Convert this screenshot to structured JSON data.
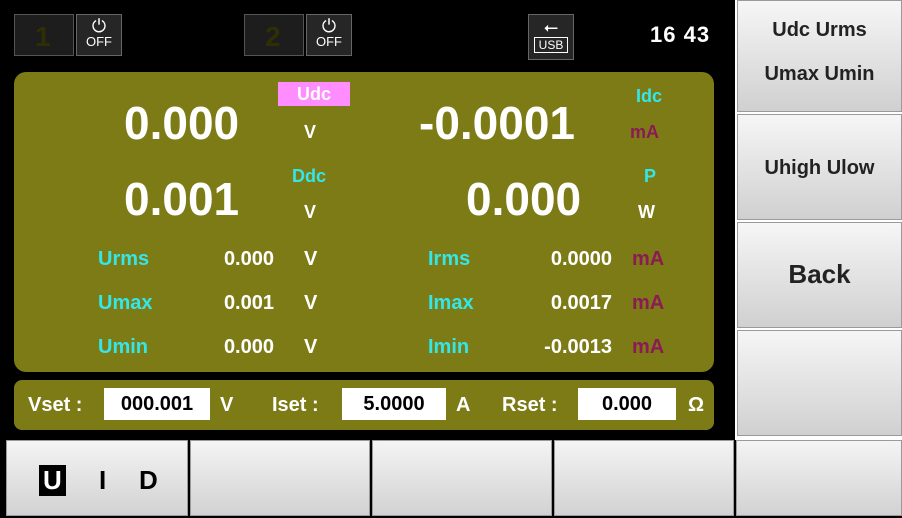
{
  "status": {
    "ch1_num": "1",
    "ch1_state": "OFF",
    "ch2_num": "2",
    "ch2_state": "OFF",
    "usb_label": "USB",
    "power_symbol": "⏻",
    "usb_symbol": "⭠",
    "time": "16 43"
  },
  "main": {
    "voltage_value": "0.000",
    "voltage_tag": "Udc",
    "voltage_unit": "V",
    "current_value": "-0.0001",
    "current_tag": "Idc",
    "current_unit": "mA",
    "ddc_value": "0.001",
    "ddc_tag": "Ddc",
    "ddc_unit": "V",
    "power_value": "0.000",
    "power_tag": "P",
    "power_unit": "W",
    "rows": [
      {
        "label": "Urms",
        "value": "0.000",
        "unit": "V",
        "label2": "Irms",
        "value2": "0.0000",
        "unit2": "mA"
      },
      {
        "label": "Umax",
        "value": "0.001",
        "unit": "V",
        "label2": "Imax",
        "value2": "0.0017",
        "unit2": "mA"
      },
      {
        "label": "Umin",
        "value": "0.000",
        "unit": "V",
        "label2": "Imin",
        "value2": "-0.0013",
        "unit2": "mA"
      }
    ]
  },
  "setbar": {
    "vset_label": "Vset :",
    "vset_value": "000.001",
    "vset_unit": "V",
    "iset_label": "Iset :",
    "iset_value": "5.0000",
    "iset_unit": "A",
    "rset_label": "Rset :",
    "rset_value": "0.000",
    "rset_unit": "Ω"
  },
  "bottom": {
    "u_label": "U",
    "i_label": "I",
    "d_label": "D"
  },
  "right": {
    "key1_line1": "Udc   Urms",
    "key1_line2": "Umax  Umin",
    "key2": "Uhigh  Ulow",
    "key3": "Back"
  },
  "colors": {
    "panel": "#7d7b16",
    "label_cyan": "#35e6e6",
    "unit_magenta": "#8c1a54",
    "highlight_pink": "#ff8dff"
  }
}
